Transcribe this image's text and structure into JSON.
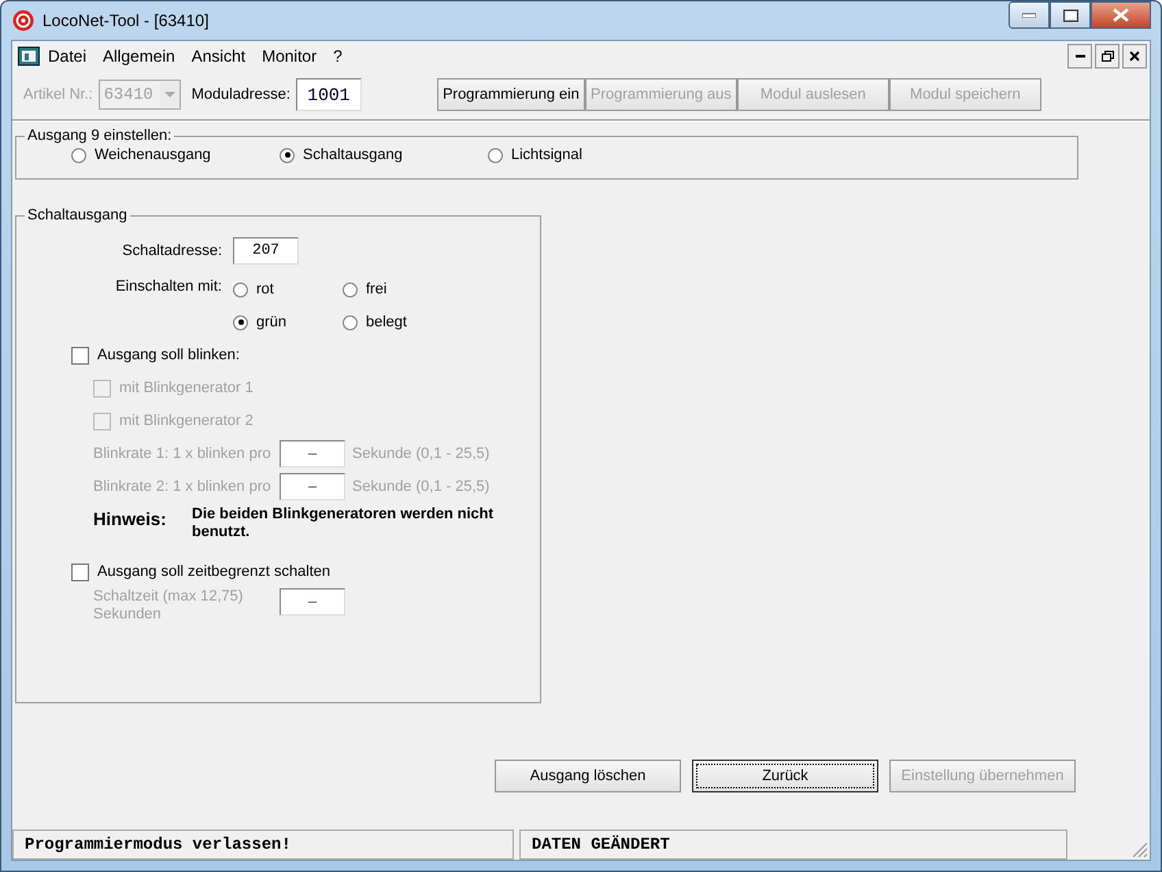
{
  "window": {
    "title": "LocoNet-Tool - [63410]"
  },
  "menu": [
    {
      "label": "Datei"
    },
    {
      "label": "Allgemein"
    },
    {
      "label": "Ansicht"
    },
    {
      "label": "Monitor"
    },
    {
      "label": "?"
    }
  ],
  "toolbar": {
    "article_label": "Artikel Nr.:",
    "article_value": "63410",
    "module_label": "Moduladresse:",
    "module_value": "1001",
    "buttons": [
      {
        "label": "Programmierung ein",
        "disabled": false
      },
      {
        "label": "Programmierung aus",
        "disabled": true
      },
      {
        "label": "Modul auslesen",
        "disabled": true
      },
      {
        "label": "Modul speichern",
        "disabled": true
      }
    ]
  },
  "output_group": {
    "title": "Ausgang 9 einstellen:",
    "options": [
      {
        "label": "Weichenausgang",
        "selected": false
      },
      {
        "label": "Schaltausgang",
        "selected": true
      },
      {
        "label": "Lichtsignal",
        "selected": false
      }
    ]
  },
  "switch_group": {
    "title": "Schaltausgang",
    "address_label": "Schaltadresse:",
    "address_value": "207",
    "switch_on_label": "Einschalten mit:",
    "switch_options": [
      {
        "label": "rot",
        "selected": false
      },
      {
        "label": "frei",
        "selected": false
      },
      {
        "label": "grün",
        "selected": true
      },
      {
        "label": "belegt",
        "selected": false
      }
    ],
    "blink": {
      "label": "Ausgang soll blinken:",
      "checked": false
    },
    "generators": [
      {
        "label": "mit Blinkgenerator 1",
        "checked": false,
        "disabled": true
      },
      {
        "label": "mit Blinkgenerator 2",
        "checked": false,
        "disabled": true
      }
    ],
    "rates": [
      {
        "label": "Blinkrate 1: 1 x blinken pro",
        "value": "–",
        "unit": "Sekunde (0,1 - 25,5)",
        "disabled": true
      },
      {
        "label": "Blinkrate 2: 1 x blinken pro",
        "value": "–",
        "unit": "Sekunde (0,1 - 25,5)",
        "disabled": true
      }
    ],
    "note_label": "Hinweis:",
    "note_text": "Die beiden Blinkgeneratoren werden nicht benutzt.",
    "timed": {
      "label": "Ausgang soll zeitbegrenzt schalten",
      "checked": false
    },
    "time_label": "Schaltzeit (max 12,75) Sekunden",
    "time_value": "–",
    "time_disabled": true
  },
  "actions": [
    {
      "label": "Ausgang löschen",
      "disabled": false,
      "focused": false
    },
    {
      "label": "Zurück",
      "disabled": false,
      "focused": true
    },
    {
      "label": "Einstellung übernehmen",
      "disabled": true,
      "focused": false
    }
  ],
  "status_bar": [
    "Programmiermodus verlassen!",
    "DATEN GEÄNDERT"
  ]
}
